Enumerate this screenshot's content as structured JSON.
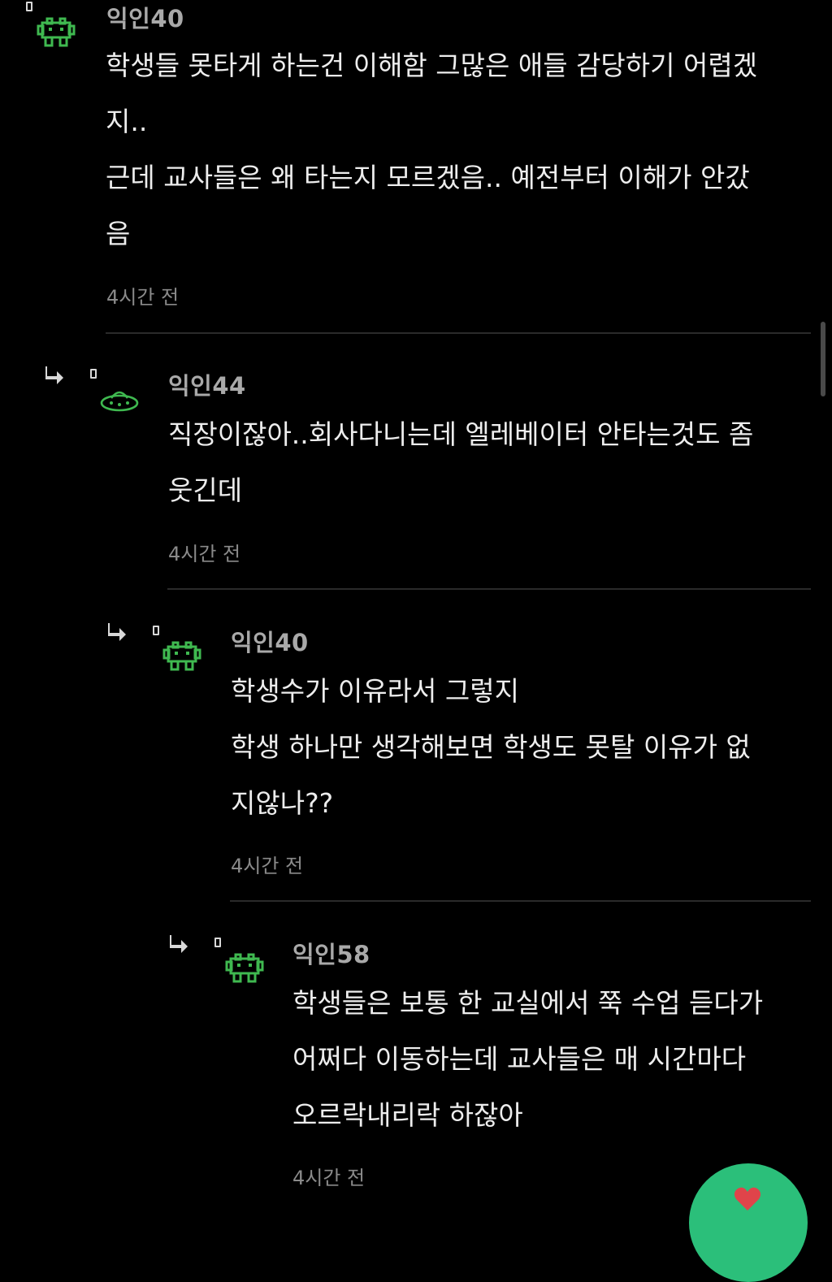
{
  "comments": [
    {
      "author": "익인40",
      "lines": [
        "학생들 못타게 하는건 이해함 그많은 애들 감당하기 어렵겠",
        "지..",
        "근데 교사들은 왜 타는지 모르겠음.. 예전부터 이해가 안갔",
        "음"
      ],
      "time": "4시간 전",
      "avatar_icon": "pixel-invader-icon"
    },
    {
      "author": "익인44",
      "lines": [
        "직장이잖아..회사다니는데 엘레베이터 안타는것도 좀",
        "웃긴데"
      ],
      "time": "4시간 전",
      "avatar_icon": "ufo-icon"
    },
    {
      "author": "익인40",
      "lines": [
        "학생수가 이유라서 그렇지",
        "학생 하나만 생각해보면 학생도 못탈 이유가 없",
        "지않나??"
      ],
      "time": "4시간 전",
      "avatar_icon": "pixel-invader-icon"
    },
    {
      "author": "익인58",
      "lines": [
        "학생들은 보통 한 교실에서 쭉 수업 듣다가",
        "어쩌다 이동하는데 교사들은 매 시간마다",
        "오르락내리락 하잖아"
      ],
      "time": "4시간 전",
      "avatar_icon": "pixel-invader-icon"
    }
  ],
  "colors": {
    "background": "#000000",
    "avatar_green": "#3fb950",
    "fab_green": "#2bbf7a",
    "fab_heart": "#e0444a"
  }
}
